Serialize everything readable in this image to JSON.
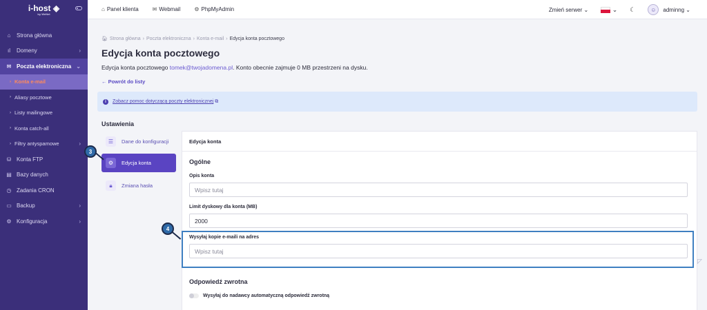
{
  "brand": {
    "name": "i-host",
    "sub": "by WeNet"
  },
  "sidebar": {
    "items": [
      {
        "label": "Strona główna",
        "icon": "home-icon",
        "glyph": "⌂",
        "chev": ""
      },
      {
        "label": "Domeny",
        "icon": "bars-icon",
        "glyph": "ıl",
        "chev": "›"
      },
      {
        "label": "Poczta elektroniczna",
        "icon": "mail-icon",
        "glyph": "✉",
        "chev": "⌄"
      },
      {
        "label": "Konta e-mail",
        "icon": "bullet",
        "glyph": "›",
        "chev": ""
      },
      {
        "label": "Aliasy pocztowe",
        "icon": "bullet",
        "glyph": "›",
        "chev": ""
      },
      {
        "label": "Listy mailingowe",
        "icon": "bullet",
        "glyph": "›",
        "chev": ""
      },
      {
        "label": "Konta catch-all",
        "icon": "bullet",
        "glyph": "›",
        "chev": ""
      },
      {
        "label": "Filtry antyspamowe",
        "icon": "bullet",
        "glyph": "›",
        "chev": "›"
      },
      {
        "label": "Konta FTP",
        "icon": "drive-icon",
        "glyph": "⛁",
        "chev": ""
      },
      {
        "label": "Bazy danych",
        "icon": "database-icon",
        "glyph": "▤",
        "chev": ""
      },
      {
        "label": "Zadania CRON",
        "icon": "clock-icon",
        "glyph": "◷",
        "chev": ""
      },
      {
        "label": "Backup",
        "icon": "backup-icon",
        "glyph": "▭",
        "chev": "›"
      },
      {
        "label": "Konfiguracja",
        "icon": "gear-icon",
        "glyph": "⚙",
        "chev": "›"
      }
    ]
  },
  "topbar": {
    "panel": "Panel klienta",
    "webmail": "Webmail",
    "phpmyadmin": "PhpMyAdmin",
    "server": "Zmień serwer ⌄",
    "lang_chev": "⌄",
    "user": "adminng ⌄"
  },
  "breadcrumb": {
    "home": "Strona główna",
    "sep": "›",
    "mail": "Poczta elektroniczna",
    "accounts": "Konta e-mail",
    "current": "Edycja konta pocztowego"
  },
  "page": {
    "title": "Edycja konta pocztowego",
    "desc_prefix": "Edycja konta pocztowego ",
    "email": "tomek@twojadomena.pl",
    "desc_suffix": ". Konto obecnie zajmuje 0 MB przestrzeni na dysku.",
    "back": "← Powrót do listy",
    "info_link": "Zobacz pomoc dotyczącą poczty elektronicznej",
    "settings": "Ustawienia"
  },
  "tabs": [
    {
      "label": "Dane do konfiguracji"
    },
    {
      "label": "Edycja konta"
    },
    {
      "label": "Zmiana hasła"
    }
  ],
  "panel": {
    "header": "Edycja konta",
    "general": "Ogólne",
    "desc_label": "Opis konta",
    "desc_placeholder": "Wpisz tutaj",
    "limit_label": "Limit dyskowy dla konta (MB)",
    "limit_value": "2000",
    "copy_label": "Wysyłaj kopie e-maili na adres",
    "copy_placeholder": "Wpisz tutaj",
    "reply_title": "Odpowiedź zwrotna",
    "reply_toggle": "Wysyłaj do nadawcy automatyczną odpowiedź zwrotną"
  },
  "markers": {
    "m3": "3",
    "m4": "4"
  },
  "colors": {
    "sidebar": "#3b2f7a",
    "accent": "#5a44c2",
    "highlight": "#3e7fc1",
    "active_sub": "#ff8a5c"
  }
}
